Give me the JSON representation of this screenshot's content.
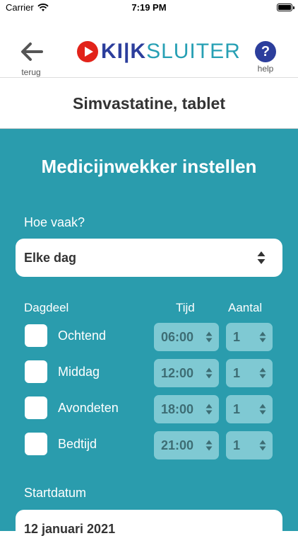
{
  "status_bar": {
    "carrier": "Carrier",
    "time": "7:19 PM"
  },
  "header": {
    "back_label": "terug",
    "help_symbol": "?",
    "help_label": "help",
    "logo": {
      "part1": "KI|K",
      "part2": "SLUITER"
    }
  },
  "product_title": "Simvastatine, tablet",
  "form": {
    "title": "Medicijnwekker instellen",
    "frequency_label": "Hoe vaak?",
    "frequency_value": "Elke dag",
    "columns": {
      "dagdeel": "Dagdeel",
      "tijd": "Tijd",
      "aantal": "Aantal"
    },
    "rows": [
      {
        "label": "Ochtend",
        "time": "06:00",
        "amount": "1"
      },
      {
        "label": "Middag",
        "time": "12:00",
        "amount": "1"
      },
      {
        "label": "Avondeten",
        "time": "18:00",
        "amount": "1"
      },
      {
        "label": "Bedtijd",
        "time": "21:00",
        "amount": "1"
      }
    ],
    "start_label": "Startdatum",
    "start_date": "12 januari 2021"
  },
  "colors": {
    "teal": "#2a9cad",
    "brand_blue": "#2c3e9c",
    "brand_red": "#e2231a"
  }
}
